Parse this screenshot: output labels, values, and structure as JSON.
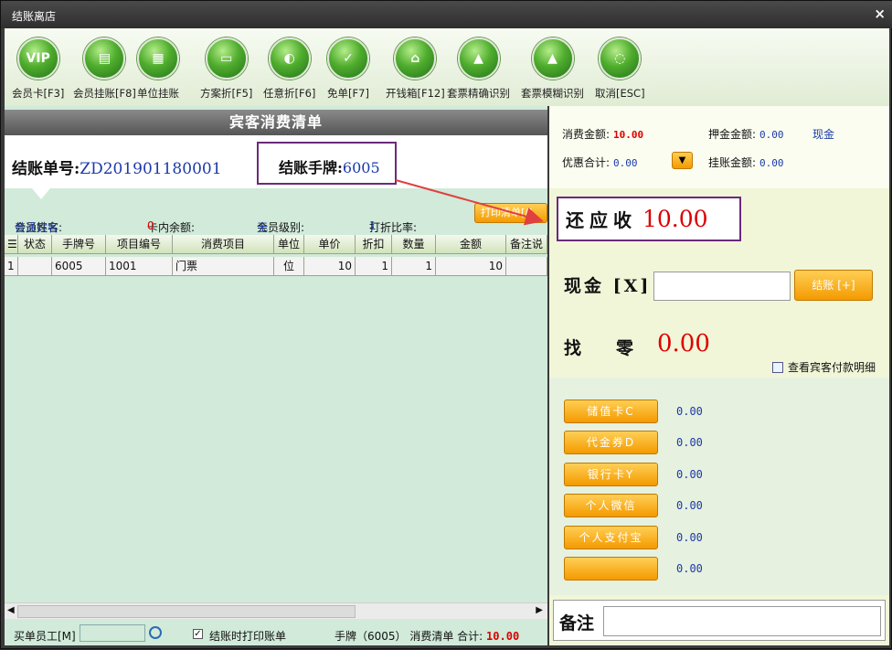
{
  "window": {
    "title": "结账离店",
    "close_label": "×"
  },
  "toolbar": {
    "buttons": [
      {
        "label": "会员卡[F3]",
        "icon": "vip-icon",
        "glyph": "VIP"
      },
      {
        "label": "会员挂账[F8]",
        "icon": "member-credit-icon",
        "glyph": "▤"
      },
      {
        "label": "单位挂账",
        "icon": "company-credit-icon",
        "glyph": "▦"
      },
      {
        "label": "方案折[F5]",
        "icon": "plan-discount-icon",
        "glyph": "▭"
      },
      {
        "label": "任意折[F6]",
        "icon": "custom-discount-icon",
        "glyph": "◐"
      },
      {
        "label": "免单[F7]",
        "icon": "free-order-icon",
        "glyph": "✓"
      },
      {
        "label": "开钱箱[F12]",
        "icon": "cash-drawer-icon",
        "glyph": "⌂"
      },
      {
        "label": "套票精确识别",
        "icon": "package-exact-icon",
        "glyph": "▲"
      },
      {
        "label": "套票模糊识别",
        "icon": "package-fuzzy-icon",
        "glyph": "▲"
      },
      {
        "label": "取消[ESC]",
        "icon": "cancel-icon",
        "glyph": "◌"
      }
    ]
  },
  "bill": {
    "header": "宾客消费清单",
    "order_no_label": "结账单号:",
    "order_no": "ZD201901180001",
    "plate_label": "结账手牌:",
    "plate": "6005",
    "member_name_label": "会员姓名:",
    "member_name": "普通宾客",
    "card_balance_label": "卡内余额:",
    "card_balance": "0",
    "member_level_label": "会员级别:",
    "member_level": "无",
    "discount_rate_label": "打折比率:",
    "discount_rate": "1",
    "print_button": "打印清单[/]",
    "columns": [
      "☰",
      "状态",
      "手牌号",
      "项目编号",
      "消费项目",
      "单位",
      "单价",
      "折扣",
      "数量",
      "金额",
      "备注说"
    ],
    "rows": [
      [
        "1",
        "",
        "6005",
        "1001",
        "门票",
        "位",
        "10",
        "1",
        "1",
        "10",
        ""
      ]
    ]
  },
  "left_footer": {
    "staff_label": "买单员工[M]",
    "print_on_settle_label": "结账时打印账单",
    "print_on_settle_checked": "✓",
    "summary_label": "手牌（6005） 消费清单 合计:",
    "summary_total": "10.00"
  },
  "summary": {
    "consumption_label": "消费金额:",
    "consumption": "10.00",
    "deposit_label": "押金金额:",
    "deposit": "0.00",
    "deposit_method": "现金",
    "discount_total_label": "优惠合计:",
    "discount_total": "0.00",
    "dropdown_glyph": "▼",
    "on_account_label": "挂账金额:",
    "on_account": "0.00"
  },
  "payment": {
    "owed_label": "还应收",
    "owed": "10.00",
    "cash_label": "现金 [X]",
    "settle_button": "结账 [+]",
    "change_label": "找　　零",
    "change": "0.00",
    "view_detail_label": "查看宾客付款明细",
    "methods": [
      {
        "label": "储值卡C",
        "value": "0.00"
      },
      {
        "label": "代金券D",
        "value": "0.00"
      },
      {
        "label": "银行卡Y",
        "value": "0.00"
      },
      {
        "label": "个人微信",
        "value": "0.00"
      },
      {
        "label": "个人支付宝",
        "value": "0.00"
      },
      {
        "label": "",
        "value": "0.00"
      }
    ],
    "remark_label": "备注"
  },
  "colors": {
    "accent_orange": "#f49a00",
    "highlight_purple": "#6a2a7a",
    "amount_red": "#dd0000",
    "value_blue": "#1a3aa8",
    "annotation_arrow": "#e04040"
  }
}
